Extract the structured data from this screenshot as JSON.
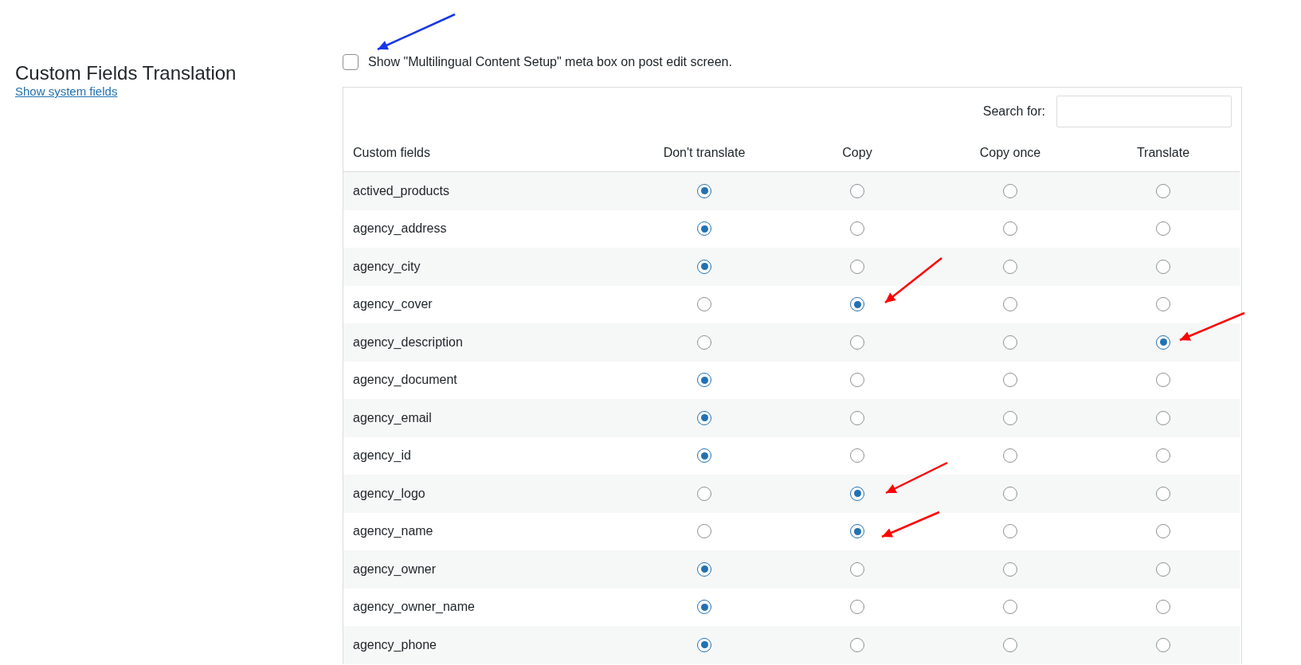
{
  "section": {
    "title": "Custom Fields Translation",
    "link": "Show system fields"
  },
  "meta_box_option": {
    "label": "Show \"Multilingual Content Setup\" meta box on post edit screen.",
    "checked": false
  },
  "search": {
    "label": "Search for:"
  },
  "table": {
    "columns": [
      "Custom fields",
      "Don't translate",
      "Copy",
      "Copy once",
      "Translate"
    ],
    "rows": [
      {
        "field": "actived_products",
        "choices": [
          {
            "selected": true
          },
          {
            "selected": false
          },
          {
            "selected": false
          },
          {
            "selected": false
          }
        ]
      },
      {
        "field": "agency_address",
        "choices": [
          {
            "selected": true
          },
          {
            "selected": false
          },
          {
            "selected": false
          },
          {
            "selected": false
          }
        ]
      },
      {
        "field": "agency_city",
        "choices": [
          {
            "selected": true
          },
          {
            "selected": false
          },
          {
            "selected": false
          },
          {
            "selected": false
          }
        ]
      },
      {
        "field": "agency_cover",
        "choices": [
          {
            "selected": false
          },
          {
            "selected": true
          },
          {
            "selected": false
          },
          {
            "selected": false
          }
        ]
      },
      {
        "field": "agency_description",
        "choices": [
          {
            "selected": false
          },
          {
            "selected": false
          },
          {
            "selected": false
          },
          {
            "selected": true
          }
        ]
      },
      {
        "field": "agency_document",
        "choices": [
          {
            "selected": true
          },
          {
            "selected": false
          },
          {
            "selected": false
          },
          {
            "selected": false
          }
        ]
      },
      {
        "field": "agency_email",
        "choices": [
          {
            "selected": true
          },
          {
            "selected": false
          },
          {
            "selected": false
          },
          {
            "selected": false
          }
        ]
      },
      {
        "field": "agency_id",
        "choices": [
          {
            "selected": true
          },
          {
            "selected": false
          },
          {
            "selected": false
          },
          {
            "selected": false
          }
        ]
      },
      {
        "field": "agency_logo",
        "choices": [
          {
            "selected": false
          },
          {
            "selected": true
          },
          {
            "selected": false
          },
          {
            "selected": false
          }
        ]
      },
      {
        "field": "agency_name",
        "choices": [
          {
            "selected": false
          },
          {
            "selected": true
          },
          {
            "selected": false
          },
          {
            "selected": false
          }
        ]
      },
      {
        "field": "agency_owner",
        "choices": [
          {
            "selected": true
          },
          {
            "selected": false
          },
          {
            "selected": false
          },
          {
            "selected": false
          }
        ]
      },
      {
        "field": "agency_owner_name",
        "choices": [
          {
            "selected": true
          },
          {
            "selected": false
          },
          {
            "selected": false
          },
          {
            "selected": false
          }
        ]
      },
      {
        "field": "agency_phone",
        "choices": [
          {
            "selected": true
          },
          {
            "selected": false
          },
          {
            "selected": false
          },
          {
            "selected": false
          }
        ]
      }
    ]
  }
}
